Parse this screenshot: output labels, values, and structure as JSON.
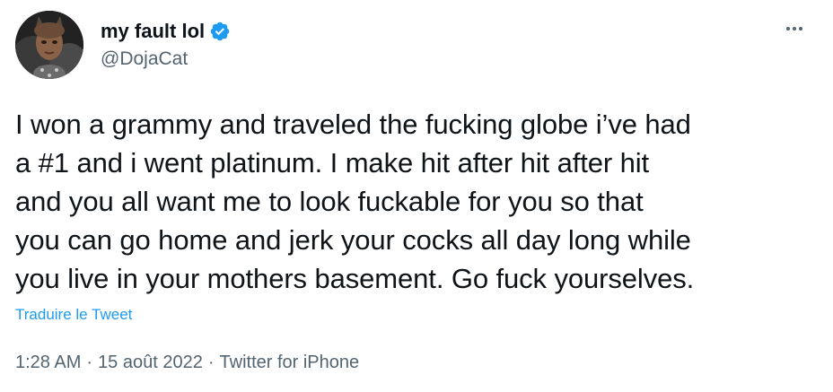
{
  "author": {
    "display_name": "my fault lol",
    "handle": "@DojaCat",
    "verified": true,
    "avatar_icon": "avatar-image"
  },
  "menu_icon": "more-horizontal-icon",
  "tweet": {
    "text": "I won a grammy and traveled the fucking globe i’ve had\na #1 and i went platinum. I make hit after hit after hit\nand you all want me to look fuckable for you so that\nyou can go home and jerk your cocks all day long while\nyou live in your mothers basement. Go fuck yourselves.",
    "translate_label": "Traduire le Tweet"
  },
  "meta": {
    "time": "1:28 AM",
    "separator": "·",
    "date": "15 août 2022",
    "source": "Twitter for iPhone"
  },
  "colors": {
    "accent": "#1d9bf0",
    "text": "#0f1419",
    "secondary": "#536471"
  }
}
